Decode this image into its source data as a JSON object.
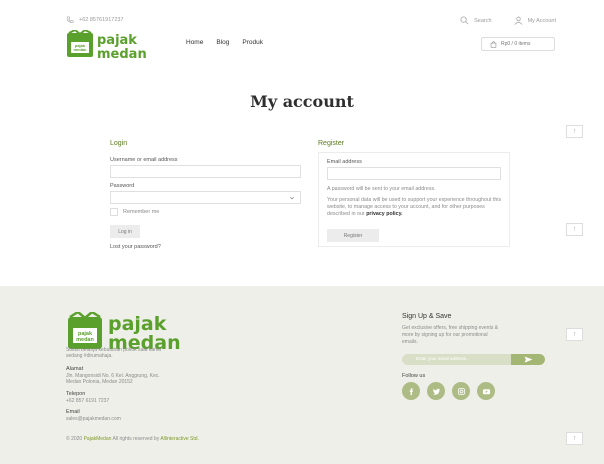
{
  "topbar": {
    "phone_icon": "phone-icon",
    "phone": "+62 85761917237",
    "search": "Search",
    "account": "My Account"
  },
  "brand": {
    "word1": "pajak",
    "word2": "medan",
    "badge": "pajak medan"
  },
  "nav": {
    "home": "Home",
    "blog": "Blog",
    "produk": "Produk"
  },
  "cart": {
    "label": "Rp0 / 0 items"
  },
  "page_title": "My account",
  "login": {
    "title": "Login",
    "username_label": "Username or email address",
    "password_label": "Password",
    "remember": "Remember me",
    "button": "Log in",
    "lost": "Lost your password?"
  },
  "register": {
    "title": "Register",
    "email_label": "Email address",
    "note": "A password will be sent to your email address.",
    "privacy_pre": "Your personal data will be used to support your experience throughout this website, to manage access to your account, and for other purposes described in our",
    "privacy_link": "privacy policy.",
    "button": "Register"
  },
  "footer": {
    "tagline_1": "Solusi belanja kebutuhan pokok saat kamu",
    "tagline_2": "sedang #dirumahaja.",
    "address_head": "Alamat",
    "address_1": "Jln. Mangonsidi No. 6 Kel. Anggrung, Kec.",
    "address_2": "Medan Polonia, Medan 20152",
    "phone_head": "Telepon",
    "phone": "+62 857 6191 7237",
    "email_head": "Email",
    "email": "sales@pajakmedan.com",
    "signup_title": "Sign Up & Save",
    "signup_1": "Get exclusive offers, free shipping events &",
    "signup_2": "more by signing up for our promotional",
    "signup_3": "emails.",
    "email_placeholder": "Enter your email address...",
    "follow": "Follow us",
    "copy_pre": "© 2020",
    "copy_brand": "PajakMedan",
    "copy_mid": "All rights reserved by",
    "copy_company": "Allinteractive Std."
  },
  "colors": {
    "brand_green": "#5aa02c",
    "accent_olive": "#a4b673",
    "footer_bg": "#efefe9"
  }
}
